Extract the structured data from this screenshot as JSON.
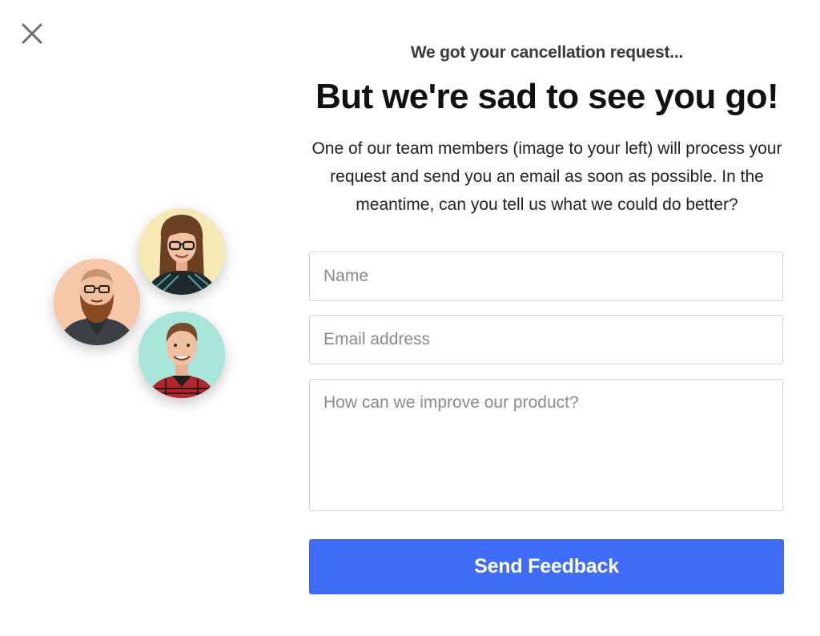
{
  "dialog": {
    "close_icon": "close-icon",
    "eyebrow": "We got your cancellation request...",
    "headline": "But we're sad to see you go!",
    "description": "One of our team members (image to your left) will process your request and send you an email as soon as possible. In the meantime, can you tell us what we could do better?"
  },
  "team_avatars": [
    {
      "icon": "avatar",
      "bg_color": "#f6c7a9"
    },
    {
      "icon": "avatar",
      "bg_color": "#f7e9b4"
    },
    {
      "icon": "avatar",
      "bg_color": "#a9e6da"
    }
  ],
  "form": {
    "name": {
      "value": "",
      "placeholder": "Name"
    },
    "email": {
      "value": "",
      "placeholder": "Email address"
    },
    "feedback": {
      "value": "",
      "placeholder": "How can we improve our product?"
    },
    "submit_label": "Send Feedback"
  },
  "colors": {
    "accent": "#3f6cf7",
    "field_border": "#d3d3d3",
    "placeholder": "#8a8a8a"
  }
}
